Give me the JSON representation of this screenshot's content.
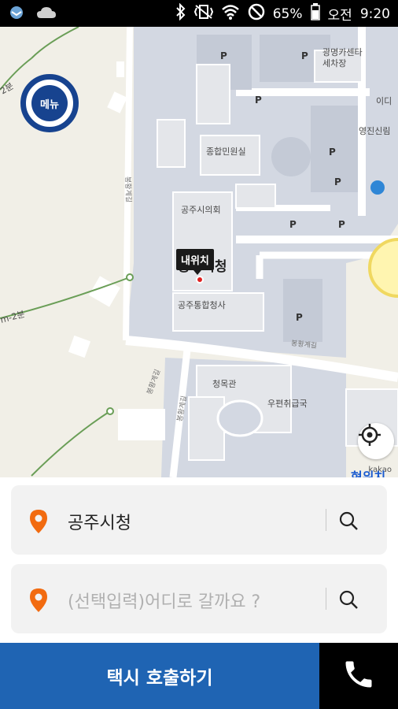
{
  "status_bar": {
    "battery": "65%",
    "ampm": "오전",
    "time": "9:20",
    "icons": [
      "bird-icon",
      "cloud-icon",
      "bluetooth-icon",
      "vibrate-icon",
      "wifi-icon",
      "no-disturb-icon",
      "battery-icon"
    ]
  },
  "map": {
    "menu_label": "메뉴",
    "my_location_tag": "내위치",
    "current_location_label": "현위치",
    "attribution": "kakao",
    "labels": {
      "city_hall": "공주시청",
      "city_council": "공주시의회",
      "civil_office": "종합민원실",
      "combined_office": "공주통합청사",
      "car_wash": "광명카센타\n세차장",
      "yeongjin": "영진신림",
      "idi": "이디",
      "cheongmok": "청목관",
      "post_office": "우편취급국",
      "walk_left": "2분",
      "walk_mid": "m-2분",
      "road_1": "봉황계길",
      "road_2": "봉황계길",
      "road_3": "봉황계길",
      "road_4": "봉황계길"
    },
    "parking_label": "P",
    "colors": {
      "land": "#f1efe7",
      "building_area": "#d3d8e2",
      "road": "#ffffff",
      "building": "#e4e6ea",
      "accent": "#17438f"
    }
  },
  "origin": {
    "value": "공주시청",
    "pin_color": "#f26b10"
  },
  "destination": {
    "placeholder": "(선택입력)어디로 갈까요 ?",
    "pin_color": "#f26b10"
  },
  "actions": {
    "call_taxi": "택시 호출하기",
    "call_color": "#1f64b3"
  }
}
